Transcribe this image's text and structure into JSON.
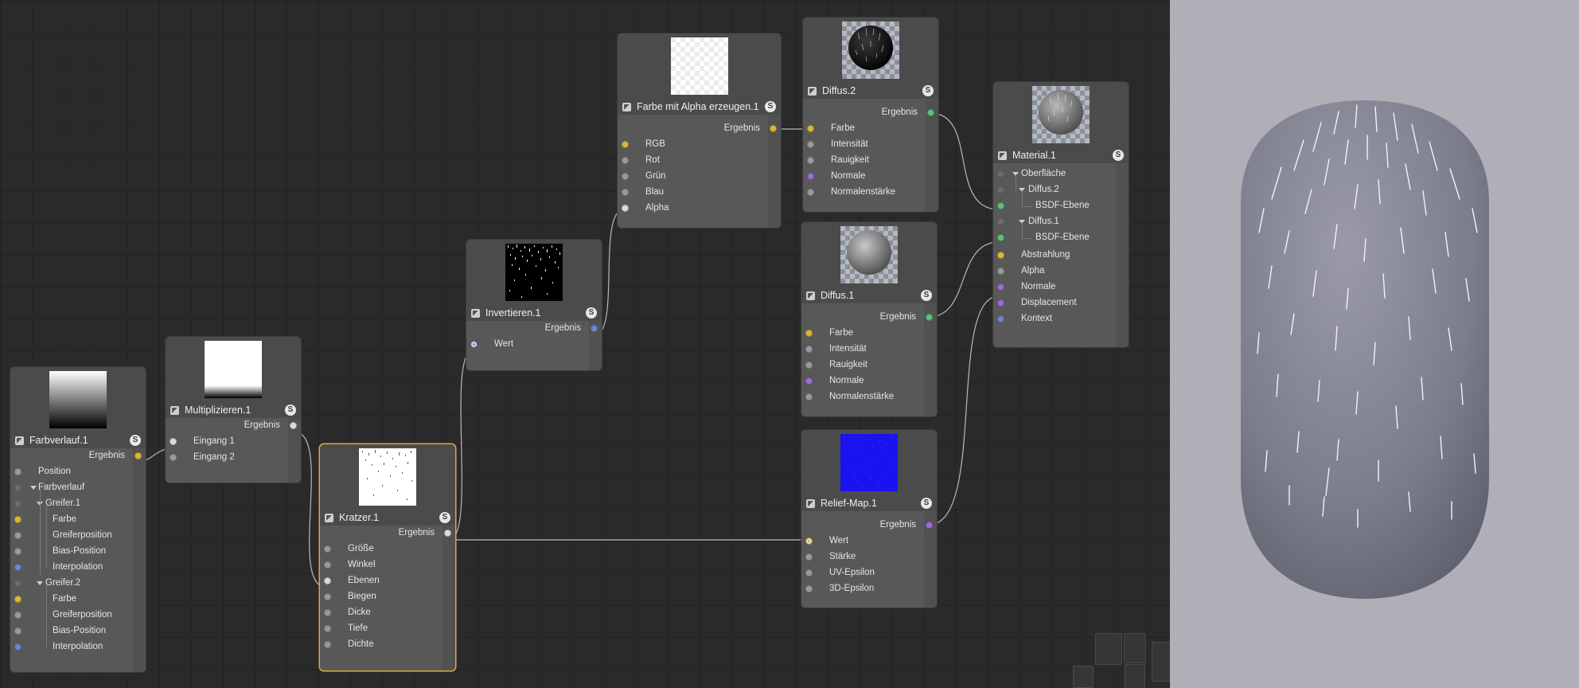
{
  "nodes": {
    "farbverlauf": {
      "title": "Farbverlauf.1",
      "output": "Ergebnis",
      "inputs": [
        "Position",
        "Farbverlauf",
        "Greifer.1",
        "Farbe",
        "Greiferposition",
        "Bias-Position",
        "Interpolation",
        "Greifer.2",
        "Farbe",
        "Greiferposition",
        "Bias-Position",
        "Interpolation"
      ]
    },
    "multiplizieren": {
      "title": "Multiplizieren.1",
      "output": "Ergebnis",
      "inputs": [
        "Eingang 1",
        "Eingang 2"
      ]
    },
    "kratzer": {
      "title": "Kratzer.1",
      "output": "Ergebnis",
      "inputs": [
        "Größe",
        "Winkel",
        "Ebenen",
        "Biegen",
        "Dicke",
        "Tiefe",
        "Dichte"
      ]
    },
    "invertieren": {
      "title": "Invertieren.1",
      "output": "Ergebnis",
      "inputs": [
        "Wert"
      ]
    },
    "farbe_alpha": {
      "title": "Farbe mit Alpha erzeugen.1",
      "output": "Ergebnis",
      "inputs": [
        "RGB",
        "Rot",
        "Grün",
        "Blau",
        "Alpha"
      ]
    },
    "diffus2": {
      "title": "Diffus.2",
      "output": "Ergebnis",
      "inputs": [
        "Farbe",
        "Intensität",
        "Rauigkeit",
        "Normale",
        "Normalenstärke"
      ]
    },
    "diffus1": {
      "title": "Diffus.1",
      "output": "Ergebnis",
      "inputs": [
        "Farbe",
        "Intensität",
        "Rauigkeit",
        "Normale",
        "Normalenstärke"
      ]
    },
    "relief": {
      "title": "Relief-Map.1",
      "output": "Ergebnis",
      "inputs": [
        "Wert",
        "Stärke",
        "UV-Epsilon",
        "3D-Epsilon"
      ]
    },
    "material": {
      "title": "Material.1",
      "inputs": [
        "Oberfläche",
        "Diffus.2",
        "BSDF-Ebene",
        "Diffus.1",
        "BSDF-Ebene",
        "Abstrahlung",
        "Alpha",
        "Normale",
        "Displacement",
        "Kontext"
      ]
    }
  },
  "solo_badge": "S",
  "colors": {
    "port_color": "#d8b73c",
    "port_bsdf": "#5fbf78",
    "port_normal": "#9b6fd1",
    "port_vector": "#6f86c9",
    "port_float": "#9a9a9a",
    "selection": "#e0a93a"
  }
}
